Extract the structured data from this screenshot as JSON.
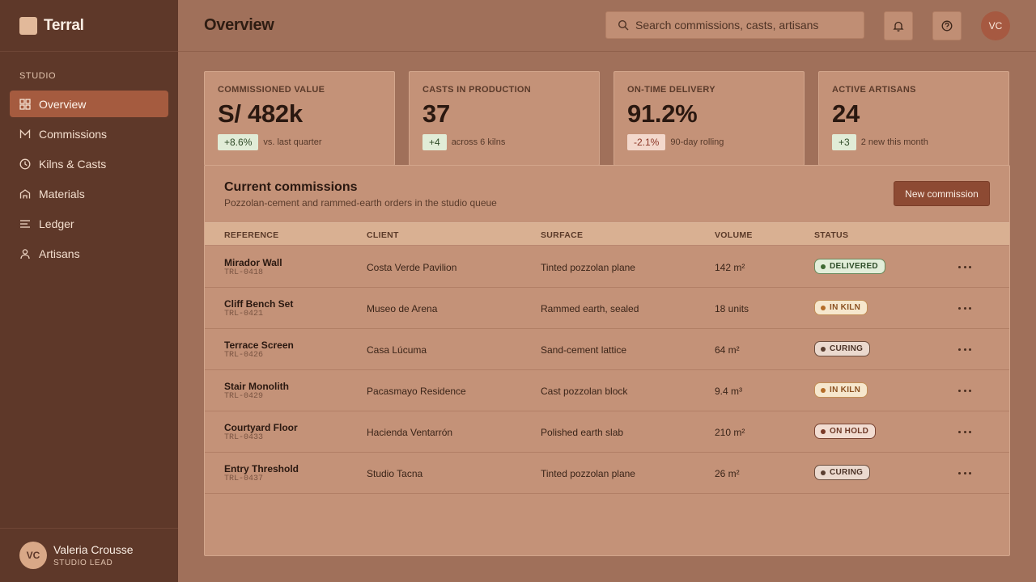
{
  "app": {
    "name": "Terral"
  },
  "sidebar": {
    "section_label": "STUDIO",
    "items": [
      {
        "label": "Overview",
        "icon": "grid-icon",
        "active": true
      },
      {
        "label": "Commissions",
        "icon": "envelope-icon"
      },
      {
        "label": "Kilns & Casts",
        "icon": "clock-icon"
      },
      {
        "label": "Materials",
        "icon": "arch-icon"
      },
      {
        "label": "Ledger",
        "icon": "lines-icon"
      },
      {
        "label": "Artisans",
        "icon": "user-icon"
      }
    ],
    "user": {
      "initials": "VC",
      "name": "Valeria Crousse",
      "role": "STUDIO LEAD"
    }
  },
  "header": {
    "title": "Overview",
    "search_placeholder": "Search commissions, casts, artisans",
    "avatar_initials": "VC"
  },
  "stats": [
    {
      "label": "COMMISSIONED VALUE",
      "value": "S/ 482k",
      "delta": "+8.6%",
      "delta_type": "pos",
      "note": "vs. last quarter"
    },
    {
      "label": "CASTS IN PRODUCTION",
      "value": "37",
      "delta": "+4",
      "delta_type": "pos",
      "note": "across 6 kilns"
    },
    {
      "label": "ON-TIME DELIVERY",
      "value": "91.2%",
      "delta": "-2.1%",
      "delta_type": "neg",
      "note": "90-day rolling"
    },
    {
      "label": "ACTIVE ARTISANS",
      "value": "24",
      "delta": "+3",
      "delta_type": "pos",
      "note": "2 new this month"
    }
  ],
  "commissions": {
    "title": "Current commissions",
    "subtitle": "Pozzolan-cement and rammed-earth orders in the studio queue",
    "new_button": "New commission",
    "columns": [
      "REFERENCE",
      "CLIENT",
      "SURFACE",
      "VOLUME",
      "STATUS"
    ],
    "rows": [
      {
        "name": "Mirador Wall",
        "code": "TRL-0418",
        "client": "Costa Verde Pavilion",
        "surface": "Tinted pozzolan plane",
        "volume": "142 m²",
        "status": "DELIVERED",
        "status_key": "delivered"
      },
      {
        "name": "Cliff Bench Set",
        "code": "TRL-0421",
        "client": "Museo de Arena",
        "surface": "Rammed earth, sealed",
        "volume": "18 units",
        "status": "IN KILN",
        "status_key": "inkiln"
      },
      {
        "name": "Terrace Screen",
        "code": "TRL-0426",
        "client": "Casa Lúcuma",
        "surface": "Sand-cement lattice",
        "volume": "64 m²",
        "status": "CURING",
        "status_key": "curing"
      },
      {
        "name": "Stair Monolith",
        "code": "TRL-0429",
        "client": "Pacasmayo Residence",
        "surface": "Cast pozzolan block",
        "volume": "9.4 m³",
        "status": "IN KILN",
        "status_key": "inkiln"
      },
      {
        "name": "Courtyard Floor",
        "code": "TRL-0433",
        "client": "Hacienda Ventarrón",
        "surface": "Polished earth slab",
        "volume": "210 m²",
        "status": "ON HOLD",
        "status_key": "onhold"
      },
      {
        "name": "Entry Threshold",
        "code": "TRL-0437",
        "client": "Studio Tacna",
        "surface": "Tinted pozzolan plane",
        "volume": "26 m²",
        "status": "CURING",
        "status_key": "curing"
      }
    ]
  },
  "colors": {
    "sidebar_bg": "#5e3829",
    "page_bg": "#a0705a",
    "card_bg": "#c49278",
    "accent": "#a55b3f",
    "primary_button": "#8d4a33"
  }
}
